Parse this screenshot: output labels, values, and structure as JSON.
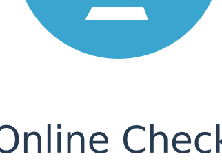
{
  "hero": {
    "icon_name": "check-in-icon",
    "icon_color": "#3aa6cf",
    "icon_glyph_color": "#ffffff"
  },
  "heading": {
    "text": "Online Check-",
    "color": "#263a52"
  },
  "background_color": "#ffffff"
}
